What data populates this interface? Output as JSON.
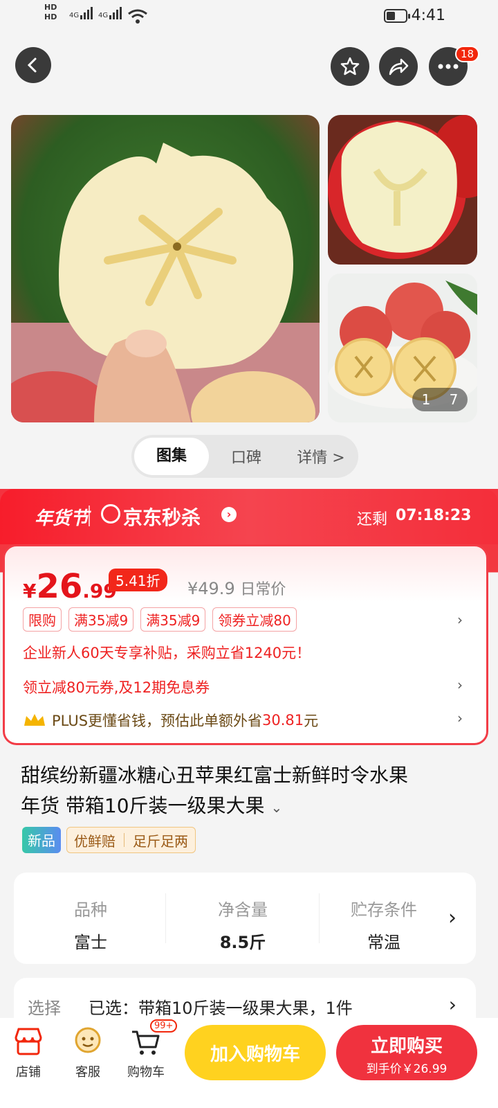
{
  "status_bar": {
    "hd1": "HD",
    "hd2": "HD",
    "net1": "4G",
    "net2": "4G",
    "time": "4:41"
  },
  "header": {
    "more_badge": "18"
  },
  "gallery": {
    "counter_current": "1",
    "counter_total": "7"
  },
  "tabs": [
    {
      "label": "图集"
    },
    {
      "label": "口碑"
    },
    {
      "label": "详情 >"
    }
  ],
  "promo": {
    "festival": "年货节",
    "brand": "京东秒杀",
    "countdown_label": "还剩",
    "countdown": "07:18:23"
  },
  "price": {
    "currency": "¥",
    "integer": "26",
    "decimal": ".99",
    "discount": "5.41折",
    "original": "¥49.9",
    "original_label": "日常价"
  },
  "coupon_tags": [
    {
      "label": "限购"
    },
    {
      "label": "满35减9"
    },
    {
      "label": "满35减9"
    },
    {
      "label": "领券立减80"
    }
  ],
  "enterprise_note": "企业新人60天专享补贴，采购立省1240元！",
  "coupon_note": "领立减80元券,及12期免息券",
  "plus": {
    "prefix": "PLUS更懂省钱，预估此单额外省",
    "amount": "30.81",
    "suffix": "元"
  },
  "product": {
    "title_line1": "甜缤纷新疆冰糖心丑苹果红富士新鲜时令水果",
    "title_line2": "年货 带箱10斤装一级果大果",
    "badge_new": "新品",
    "badge_fresh": "优鲜赔",
    "badge_weight": "足斤足两"
  },
  "specs": [
    {
      "key": "品种",
      "value": "富士"
    },
    {
      "key": "净含量",
      "value": "8.5斤"
    },
    {
      "key": "贮存条件",
      "value": "常温"
    }
  ],
  "select": {
    "label": "选择",
    "value": "已选：带箱10斤装一级果大果，1件"
  },
  "bottom_bar": {
    "shop": "店铺",
    "service": "客服",
    "cart": "购物车",
    "cart_badge": "99+",
    "add_to_cart": "加入购物车",
    "buy_now": "立即购买",
    "buy_now_sub": "到手价￥26.99"
  },
  "colors": {
    "accent": "#f2270c",
    "yellow_button": "#ffd21f",
    "red_button": "#f0323e"
  }
}
